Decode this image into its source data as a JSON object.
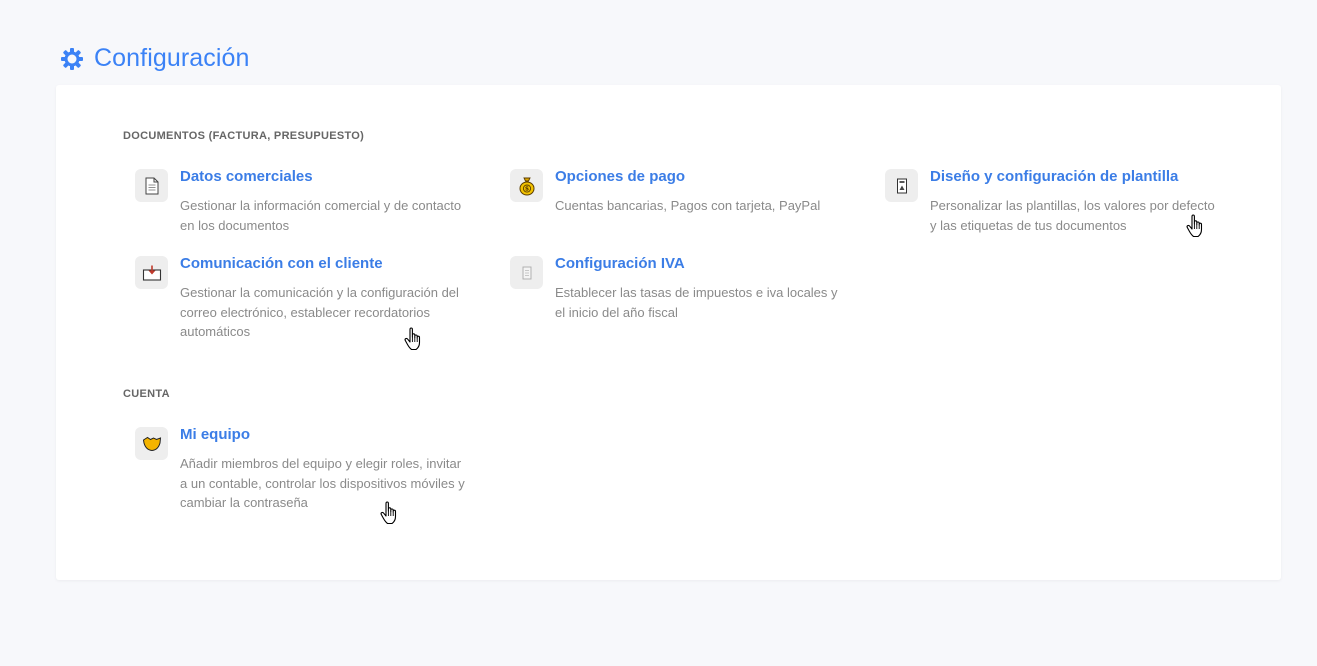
{
  "header": {
    "title": "Configuración",
    "icon": "gear-icon",
    "accent_color": "#3b82f6"
  },
  "sections": {
    "documents": {
      "title": "DOCUMENTOS (FACTURA, PRESUPUESTO)",
      "items": [
        {
          "icon": "document-icon",
          "title": "Datos comerciales",
          "description": "Gestionar la información comercial y de contacto en los documentos"
        },
        {
          "icon": "money-bag-icon",
          "title": "Opciones de pago",
          "description": "Cuentas bancarias, Pagos con tarjeta, PayPal"
        },
        {
          "icon": "template-icon",
          "title": "Diseño y configuración de plantilla",
          "description": "Personalizar las plantillas, los valores por defecto y las etiquetas de tus documentos"
        },
        {
          "icon": "inbox-icon",
          "title": "Comunicación con el cliente",
          "description": "Gestionar la comunicación y la configuración del correo electrónico, establecer recordatorios automáticos"
        },
        {
          "icon": "tax-icon",
          "title": "Configuración IVA",
          "description": "Establecer las tasas de impuestos e iva locales y el inicio del año fiscal"
        }
      ]
    },
    "account": {
      "title": "CUENTA",
      "items": [
        {
          "icon": "team-icon",
          "title": "Mi equipo",
          "description": "Añadir miembros del equipo y elegir roles, invitar a un contable, controlar los dispositivos móviles y cambiar la contraseña"
        }
      ]
    }
  }
}
